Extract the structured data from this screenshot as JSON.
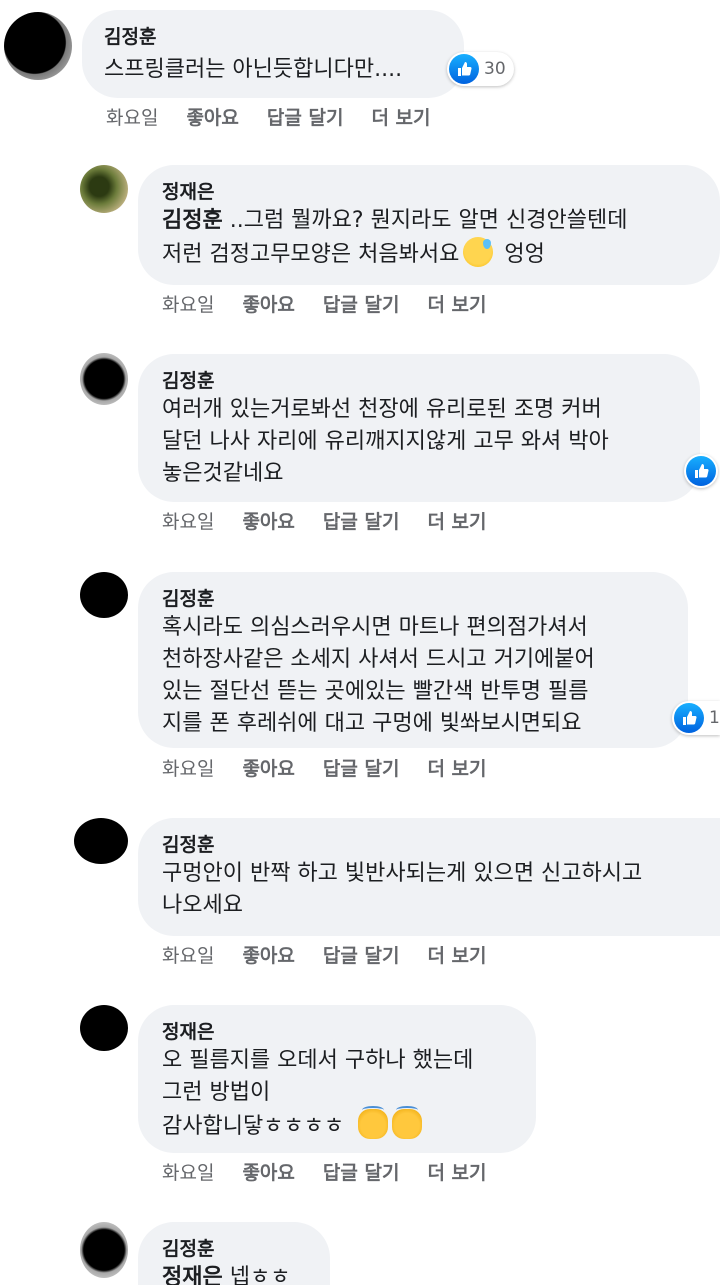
{
  "actions": {
    "time": "화요일",
    "like": "좋아요",
    "reply": "답글 달기",
    "more": "더 보기"
  },
  "comments": [
    {
      "author": "김정훈",
      "text": "스프링클러는 아닌듯합니다만....",
      "reaction_count": "30"
    },
    {
      "author": "정재은",
      "mention": "김정훈",
      "text": " ..그럼 뭘까요? 뭔지라도 알면 신경안쓸텐데\n저런 검정고무모양은 처음봐서요",
      "text_tail": " 엉엉",
      "emoji": "grinning-sweat-emoji"
    },
    {
      "author": "김정훈",
      "text": "여러개 있는거로봐선 천장에 유리로된 조명 커버\n달던 나사 자리에 유리깨지지않게 고무 와셔 박아\n놓은것같네요"
    },
    {
      "author": "김정훈",
      "text": "혹시라도 의심스러우시면 마트나 편의점가셔서\n천하장사같은 소세지 사셔서 드시고 거기에붙어\n있는 절단선 뜯는 곳에있는 빨간색 반투명 필름\n지를 폰 후레쉬에 대고 구멍에 빛쏴보시면되요",
      "reaction_count": "1"
    },
    {
      "author": "김정훈",
      "text": "구멍안이 반짝 하고 빛반사되는게 있으면 신고하시고\n나오세요"
    },
    {
      "author": "정재은",
      "text": "오 필름지를 오데서 구하나 했는데\n그런 방법이\n감사합니닿ㅎㅎㅎㅎ",
      "emoji": "clapping-hands-emoji"
    },
    {
      "author": "김정훈",
      "mention": "정재은",
      "text": " 넵ㅎㅎ"
    }
  ],
  "colors": {
    "bubble": "#f0f2f5",
    "action_text": "#65676b",
    "like_blue": "#1877f2"
  }
}
